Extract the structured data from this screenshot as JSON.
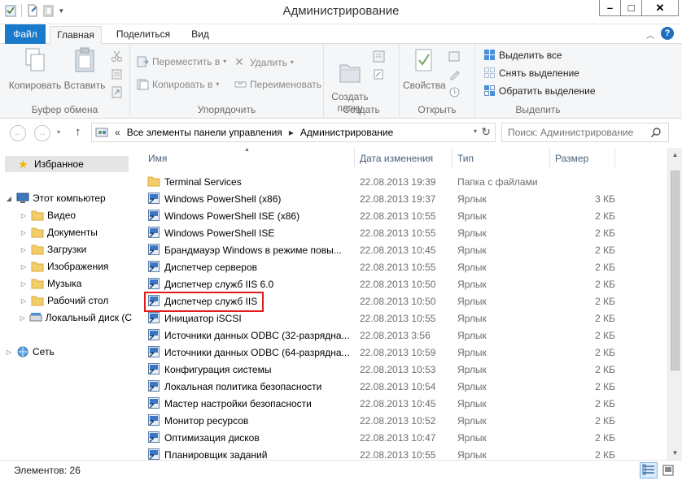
{
  "window": {
    "title": "Администрирование"
  },
  "ribbon_tabs": [
    {
      "label": "Файл"
    },
    {
      "label": "Главная"
    },
    {
      "label": "Поделиться"
    },
    {
      "label": "Вид"
    }
  ],
  "ribbon": {
    "clipboard": {
      "copy": "Копировать",
      "paste": "Вставить",
      "group": "Буфер обмена"
    },
    "organize": {
      "move_to": "Переместить в",
      "copy_to": "Копировать в",
      "delete": "Удалить",
      "rename": "Переименовать",
      "group": "Упорядочить"
    },
    "create": {
      "new_folder": "Создать\nпапку",
      "group": "Создать"
    },
    "open": {
      "properties": "Свойства",
      "group": "Открыть"
    },
    "select": {
      "select_all": "Выделить все",
      "select_none": "Снять выделение",
      "invert": "Обратить выделение",
      "group": "Выделить"
    }
  },
  "address": {
    "crumbs": [
      "Все элементы панели управления",
      "Администрирование"
    ],
    "search_placeholder": "Поиск: Администрирование"
  },
  "nav_pane": {
    "favorites": "Избранное",
    "this_pc": "Этот компьютер",
    "pc_items": [
      "Видео",
      "Документы",
      "Загрузки",
      "Изображения",
      "Музыка",
      "Рабочий стол",
      "Локальный диск (C"
    ],
    "network": "Сеть"
  },
  "columns": {
    "name": "Имя",
    "date": "Дата изменения",
    "type": "Тип",
    "size": "Размер"
  },
  "files": [
    {
      "name": "Terminal Services",
      "date": "22.08.2013 19:39",
      "type": "Папка с файлами",
      "size": "",
      "icon": "folder-icon"
    },
    {
      "name": "Windows PowerShell (x86)",
      "date": "22.08.2013 19:37",
      "type": "Ярлык",
      "size": "3 КБ",
      "icon": "powershell-icon"
    },
    {
      "name": "Windows PowerShell ISE (x86)",
      "date": "22.08.2013 10:55",
      "type": "Ярлык",
      "size": "2 КБ",
      "icon": "powershell-icon"
    },
    {
      "name": "Windows PowerShell ISE",
      "date": "22.08.2013 10:55",
      "type": "Ярлык",
      "size": "2 КБ",
      "icon": "powershell-icon"
    },
    {
      "name": "Брандмауэр Windows в режиме повы...",
      "date": "22.08.2013 10:45",
      "type": "Ярлык",
      "size": "2 КБ",
      "icon": "firewall-icon"
    },
    {
      "name": "Диспетчер серверов",
      "date": "22.08.2013 10:55",
      "type": "Ярлык",
      "size": "2 КБ",
      "icon": "server-manager-icon"
    },
    {
      "name": "Диспетчер служб IIS 6.0",
      "date": "22.08.2013 10:50",
      "type": "Ярлык",
      "size": "2 КБ",
      "icon": "iis-icon"
    },
    {
      "name": "Диспетчер служб IIS",
      "date": "22.08.2013 10:50",
      "type": "Ярлык",
      "size": "2 КБ",
      "icon": "iis-icon"
    },
    {
      "name": "Инициатор iSCSI",
      "date": "22.08.2013 10:55",
      "type": "Ярлык",
      "size": "2 КБ",
      "icon": "iscsi-icon"
    },
    {
      "name": "Источники данных ODBC (32-разрядна...",
      "date": "22.08.2013 3:56",
      "type": "Ярлык",
      "size": "2 КБ",
      "icon": "odbc-icon"
    },
    {
      "name": "Источники данных ODBC (64-разрядна...",
      "date": "22.08.2013 10:59",
      "type": "Ярлык",
      "size": "2 КБ",
      "icon": "odbc-icon"
    },
    {
      "name": "Конфигурация системы",
      "date": "22.08.2013 10:53",
      "type": "Ярлык",
      "size": "2 КБ",
      "icon": "msconfig-icon"
    },
    {
      "name": "Локальная политика безопасности",
      "date": "22.08.2013 10:54",
      "type": "Ярлык",
      "size": "2 КБ",
      "icon": "security-policy-icon"
    },
    {
      "name": "Мастер настройки безопасности",
      "date": "22.08.2013 10:45",
      "type": "Ярлык",
      "size": "2 КБ",
      "icon": "security-wizard-icon"
    },
    {
      "name": "Монитор ресурсов",
      "date": "22.08.2013 10:52",
      "type": "Ярлык",
      "size": "2 КБ",
      "icon": "resource-monitor-icon"
    },
    {
      "name": "Оптимизация дисков",
      "date": "22.08.2013 10:47",
      "type": "Ярлык",
      "size": "2 КБ",
      "icon": "defrag-icon"
    },
    {
      "name": "Планировщик заданий",
      "date": "22.08.2013 10:55",
      "type": "Ярлык",
      "size": "2 КБ",
      "icon": "task-scheduler-icon"
    }
  ],
  "status": {
    "count": "Элементов: 26"
  },
  "colors": {
    "file_tab": "#1979ca",
    "highlight_box": "#e21b1b",
    "header_text": "#4c607a"
  }
}
